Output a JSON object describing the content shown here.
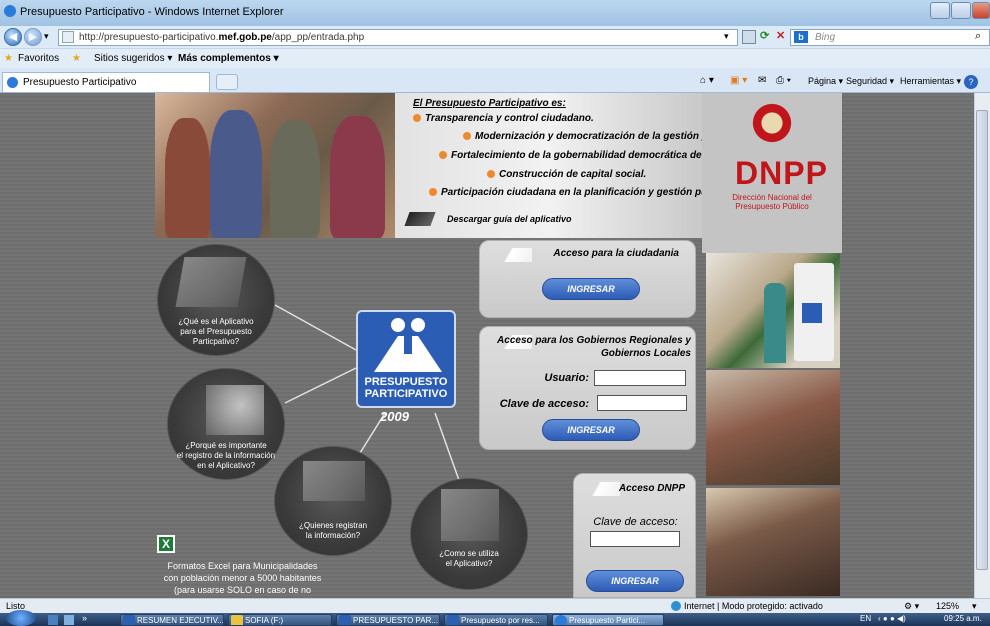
{
  "window": {
    "title": "Presupuesto Participativo - Windows Internet Explorer"
  },
  "address": {
    "url_prefix": "http://presupuesto-participativo.",
    "url_domain": "mef.gob.pe",
    "url_path": "/app_pp/entrada.php",
    "search_placeholder": "Bing"
  },
  "favorites": {
    "favoritos": "Favoritos",
    "sitios": "Sitios sugeridos ▾",
    "mas": "Más complementos ▾"
  },
  "tab": {
    "label": "Presupuesto Participativo"
  },
  "commandbar": {
    "pagina": "Página ▾",
    "seguridad": "Seguridad ▾",
    "herramientas": "Herramientas ▾"
  },
  "intro": {
    "heading": "El Presupuesto Participativo es:",
    "items": [
      "Transparencia y control ciudadano.",
      "Modernización y democratización de la gestión pública",
      "Fortalecimiento de la gobernabilidad democrática del país.",
      "Construcción de capital social.",
      "Participación ciudadana en la planificación y gestión pública."
    ],
    "download": "Descargar guía del aplicativo"
  },
  "dnpp": {
    "acronym": "DNPP",
    "name": "Dirección Nacional del Presupuesto Público"
  },
  "ciudadania": {
    "title": "Acceso para la ciudadania",
    "button": "INGRESAR"
  },
  "gobiernos": {
    "title_line1": "Acceso para los Gobiernos Regionales y",
    "title_line2": "Gobiernos Locales",
    "user_label": "Usuario:",
    "pass_label": "Clave de acceso:",
    "button": "INGRESAR"
  },
  "dnpp_access": {
    "title": "Acceso DNPP",
    "pass_label": "Clave de acceso:",
    "button": "INGRESAR"
  },
  "circles": [
    {
      "l1": "¿Qué es el Aplicativo",
      "l2": "para el  Presupuesto",
      "l3": "Particpativo?"
    },
    {
      "l1": "¿Porqué es importante",
      "l2": "el registro de la información",
      "l3": "en el Aplicativo?"
    },
    {
      "l1": "¿Quienes registran",
      "l2": "la información?"
    },
    {
      "l1": "¿Como se utiliza",
      "l2": "el Aplicativo?"
    }
  ],
  "logo": {
    "line1": "PRESUPUESTO",
    "line2": "PARTICIPATIVO",
    "year": "2009"
  },
  "excel": {
    "l1": "Formatos Excel para Municipalidades",
    "l2": "con población menor a 5000 habitantes",
    "l3": "(para usarse SOLO en caso de no"
  },
  "status": {
    "left": "Listo",
    "zone": "Internet | Modo protegido: activado",
    "zoom": "125%"
  },
  "taskbar": {
    "items": [
      "RESUMEN EJECUTIV...",
      "SOFIA (F:)",
      "PRESUPUESTO PAR...",
      "Presupuesto por res...",
      "Presupuesto Partici..."
    ],
    "lang": "EN",
    "time": "09:25 a.m."
  }
}
